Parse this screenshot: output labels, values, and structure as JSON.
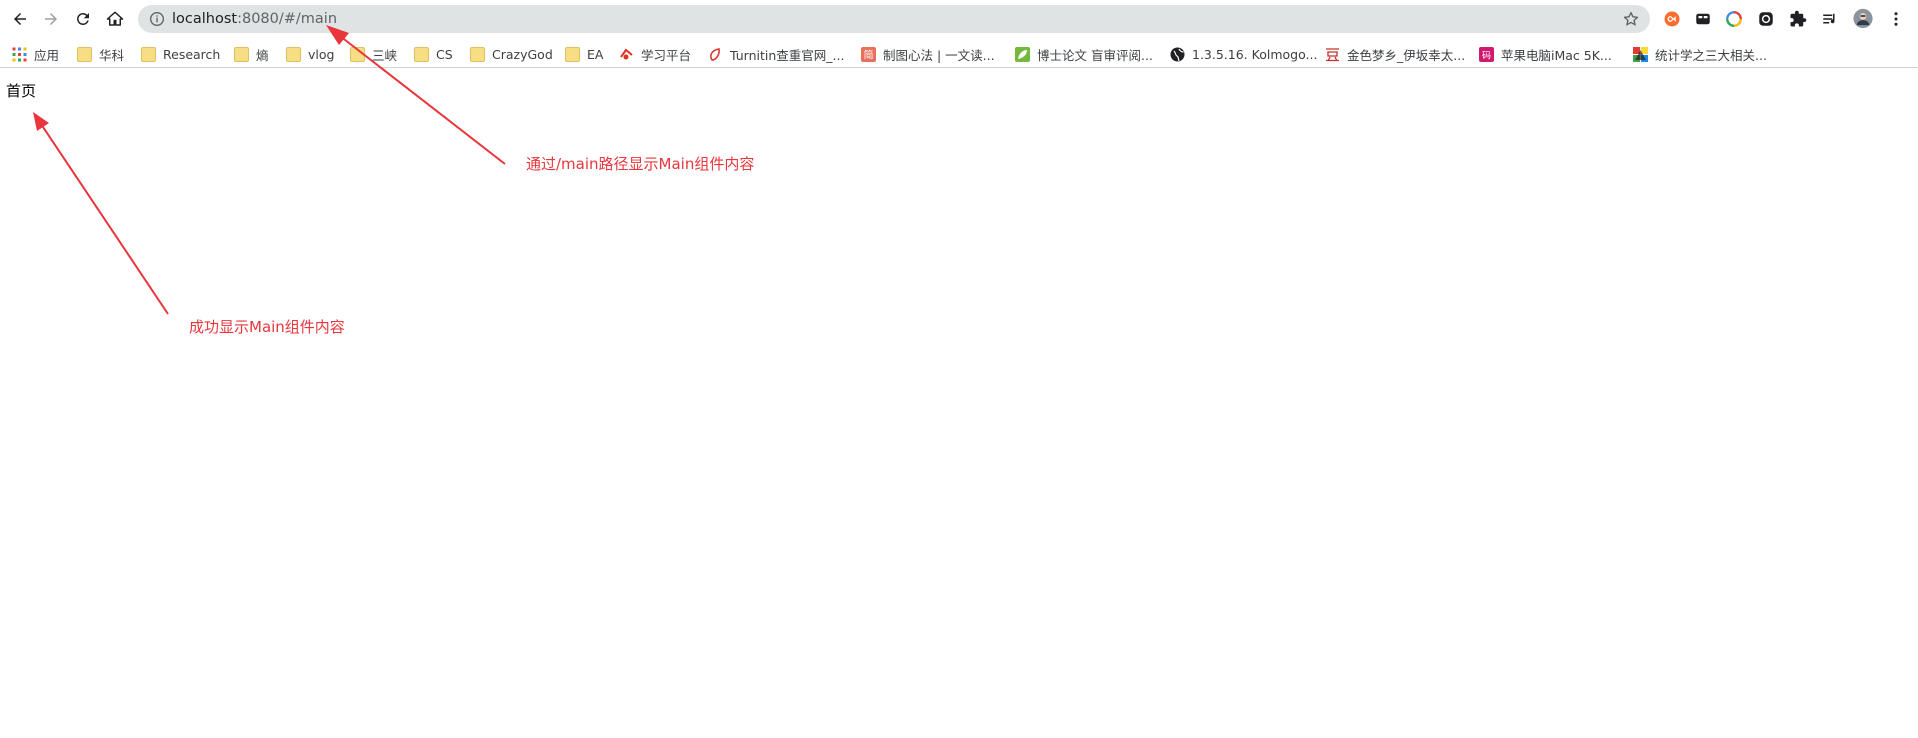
{
  "browser": {
    "url_host": "localhost",
    "url_path": ":8080/#/main"
  },
  "bookmarks": [
    {
      "label": "应用",
      "icon": "apps-grid-icon"
    },
    {
      "label": "华科",
      "icon": "folder-icon"
    },
    {
      "label": "Research",
      "icon": "folder-icon"
    },
    {
      "label": "熵",
      "icon": "folder-icon"
    },
    {
      "label": "vlog",
      "icon": "folder-icon"
    },
    {
      "label": "三峡",
      "icon": "folder-icon"
    },
    {
      "label": "CS",
      "icon": "folder-icon"
    },
    {
      "label": "CrazyGod",
      "icon": "folder-icon"
    },
    {
      "label": "EA",
      "icon": "folder-icon"
    },
    {
      "label": "学习平台",
      "icon": "study-platform-icon"
    },
    {
      "label": "Turnitin查重官网_...",
      "icon": "turnitin-icon"
    },
    {
      "label": "制图心法 | 一文读...",
      "icon": "jianshu-icon"
    },
    {
      "label": "博士论文 盲审评阅...",
      "icon": "leaf-icon"
    },
    {
      "label": "1.3.5.16. Kolmogo...",
      "icon": "globe-icon"
    },
    {
      "label": "金色梦乡_伊坂幸太...",
      "icon": "douban-icon"
    },
    {
      "label": "苹果电脑iMac 5K...",
      "icon": "zhihu-pink-icon"
    },
    {
      "label": "统计学之三大相关...",
      "icon": "colorful-blocks-icon"
    }
  ],
  "page": {
    "heading": "首页"
  },
  "annotations": {
    "url_note": "通过/main路径显示Main组件内容",
    "content_note": "成功显示Main组件内容"
  },
  "colors": {
    "annotation": "#e8363c",
    "omnibox": "#dfe3e4",
    "folder": "#f7dd84"
  }
}
